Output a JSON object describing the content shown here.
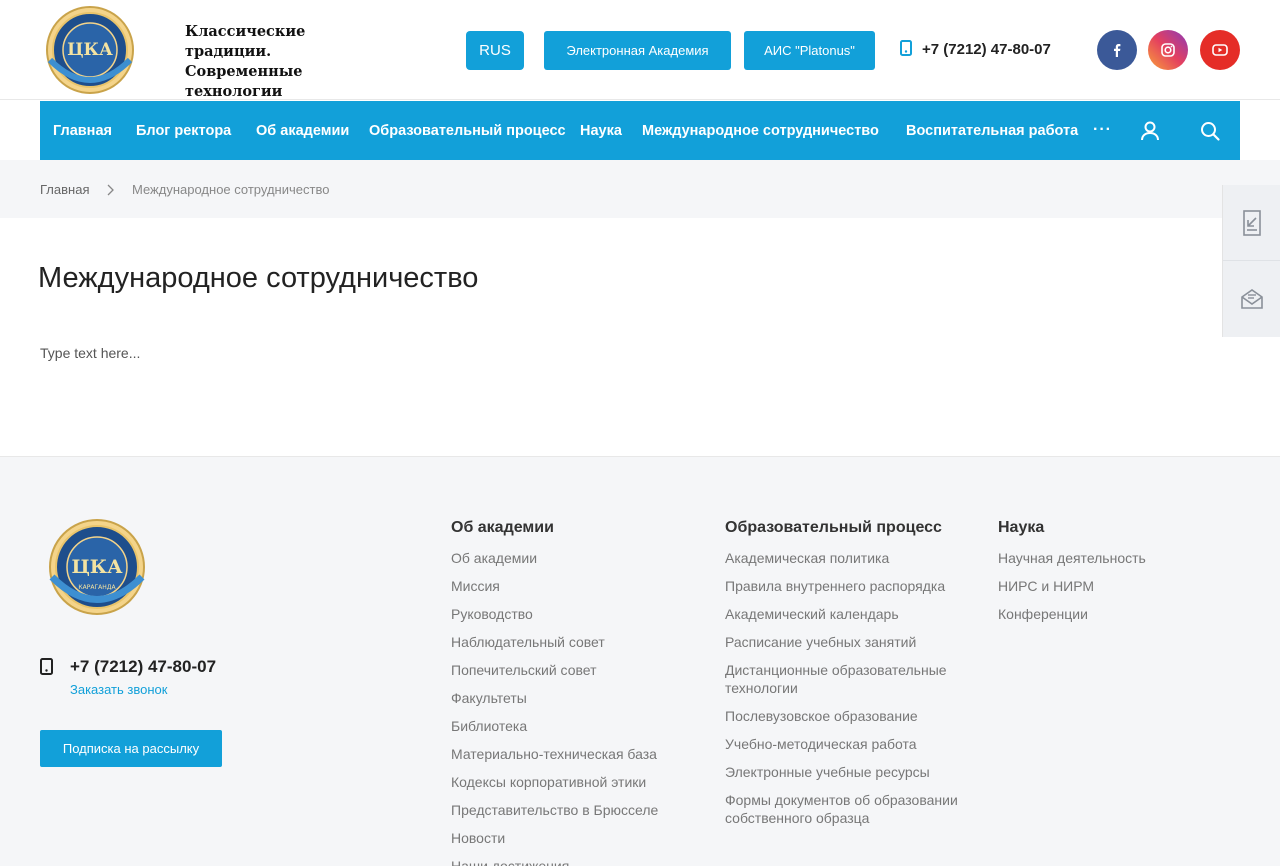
{
  "header": {
    "slogan": "Классические традиции. Современные технологии",
    "logo_text": "ЦКА",
    "logo_city": "КАРАГАНДА",
    "lang_button": "RUS",
    "btn_academy": "Электронная Академия",
    "btn_ais": "АИС \"Platonus\"",
    "phone": "+7 (7212) 47-80-07",
    "socials": [
      {
        "name": "facebook",
        "icon": "facebook-icon",
        "color": "#3b5998"
      },
      {
        "name": "instagram",
        "icon": "instagram-icon",
        "color": "#e4405f"
      },
      {
        "name": "youtube",
        "icon": "youtube-icon",
        "color": "#e52d27"
      }
    ]
  },
  "nav": {
    "items": [
      {
        "label": "Главная"
      },
      {
        "label": "Блог ректора"
      },
      {
        "label": "Об академии"
      },
      {
        "label": "Образовательный процесс"
      },
      {
        "label": "Наука"
      },
      {
        "label": "Международное сотрудничество"
      },
      {
        "label": "Воспитательная работа"
      }
    ],
    "more": "···",
    "bg_color": "#12a0d9"
  },
  "breadcrumb": {
    "home": "Главная",
    "current": "Международное сотрудничество"
  },
  "main": {
    "title": "Международное сотрудничество",
    "body": "Type text here..."
  },
  "footer": {
    "phone": "+7 (7212) 47-80-07",
    "callback": "Заказать звонок",
    "subscribe": "Подписка на рассылку",
    "columns": [
      {
        "title": "Об академии",
        "items": [
          "Об академии",
          "Миссия",
          "Руководство",
          "Наблюдательный совет",
          "Попечительский совет",
          "Факультеты",
          "Библиотека",
          "Материально-техническая база",
          "Кодексы корпоративной этики",
          "Представительство в Брюсселе",
          "Новости",
          "Наши достижения"
        ]
      },
      {
        "title": "Образовательный процесс",
        "items": [
          "Академическая политика",
          "Правила внутреннего распорядка",
          "Академический календарь",
          "Расписание учебных занятий",
          "Дистанционные образовательные технологии",
          "Послевузовское образование",
          "Учебно-методическая работа",
          "Электронные учебные ресурсы",
          "Формы документов об образовании собственного образца"
        ]
      },
      {
        "title": "Наука",
        "items": [
          "Научная деятельность",
          "НИРС и НИРМ",
          "Конференции"
        ]
      }
    ]
  }
}
